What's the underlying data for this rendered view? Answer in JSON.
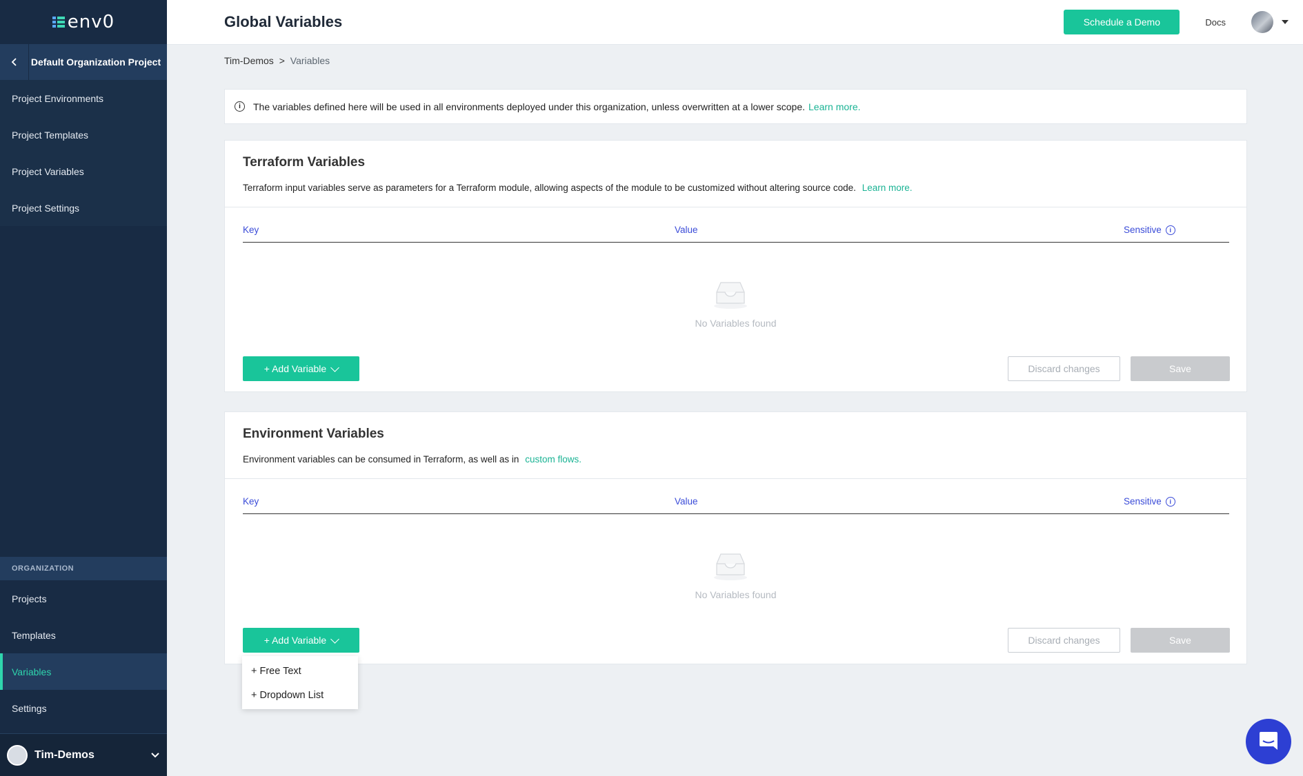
{
  "sidebar": {
    "logo_text": "env0",
    "project_title": "Default Organization Project",
    "project_nav": [
      {
        "label": "Project Environments"
      },
      {
        "label": "Project Templates"
      },
      {
        "label": "Project Variables"
      },
      {
        "label": "Project Settings"
      }
    ],
    "org_label": "ORGANIZATION",
    "org_nav": [
      {
        "label": "Projects"
      },
      {
        "label": "Templates"
      },
      {
        "label": "Variables",
        "active": true
      },
      {
        "label": "Settings"
      }
    ],
    "user_name": "Tim-Demos"
  },
  "header": {
    "title": "Global Variables",
    "demo_button": "Schedule a Demo",
    "docs_link": "Docs"
  },
  "breadcrumb": {
    "root": "Tim-Demos",
    "separator": ">",
    "current": "Variables"
  },
  "info": {
    "text": "The variables defined here will be used in all environments deployed under this organization, unless overwritten at a lower scope.",
    "link": "Learn more."
  },
  "terraform": {
    "title": "Terraform Variables",
    "desc": "Terraform input variables serve as parameters for a Terraform module, allowing aspects of the module to be customized without altering source code.",
    "link": "Learn more.",
    "columns": {
      "key": "Key",
      "value": "Value",
      "sensitive": "Sensitive"
    },
    "empty_text": "No Variables found",
    "add_button": "+ Add Variable",
    "discard_button": "Discard changes",
    "save_button": "Save"
  },
  "environment": {
    "title": "Environment Variables",
    "desc": "Environment variables can be consumed in Terraform, as well as in",
    "link": "custom flows.",
    "columns": {
      "key": "Key",
      "value": "Value",
      "sensitive": "Sensitive"
    },
    "empty_text": "No Variables found",
    "add_button": "+ Add Variable",
    "discard_button": "Discard changes",
    "save_button": "Save"
  },
  "add_menu": {
    "items": [
      {
        "label": "+ Free Text"
      },
      {
        "label": "+ Dropdown List"
      }
    ]
  },
  "colors": {
    "accent": "#19c59a",
    "sidebar_bg": "#182b44",
    "table_header": "#3a4bd8",
    "chat": "#2d3fd3"
  }
}
